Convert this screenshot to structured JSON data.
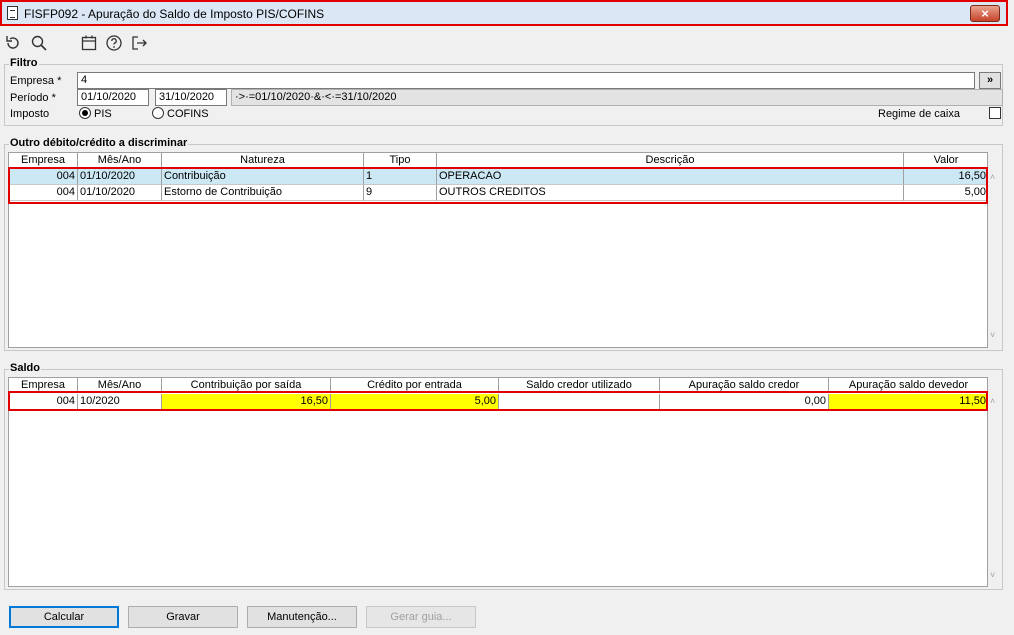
{
  "window": {
    "title": "FISFP092 - Apuração do Saldo de Imposto PIS/COFINS",
    "close_label": "×"
  },
  "toolbar": {
    "icons": [
      "undo-icon",
      "search-icon",
      "calendar-icon",
      "help-icon",
      "exit-icon"
    ]
  },
  "filtro": {
    "legend": "Filtro",
    "empresa_label": "Empresa *",
    "empresa_value": "4",
    "more_button": "»",
    "periodo_label": "Período *",
    "periodo_inicio": "01/10/2020",
    "periodo_fim": "31/10/2020",
    "periodo_expr": "·>·=01/10/2020·&·<·=31/10/2020",
    "imposto_label": "Imposto",
    "imposto_options": [
      "PIS",
      "COFINS"
    ],
    "imposto_selected": "PIS",
    "regime_label": "Regime de caixa"
  },
  "outro": {
    "legend": "Outro débito/crédito a discriminar",
    "columns": [
      "Empresa",
      "Mês/Ano",
      "Natureza",
      "Tipo",
      "Descrição",
      "Valor"
    ],
    "rows": [
      [
        "004",
        "01/10/2020",
        "Contribuição",
        "1",
        "OPERACAO",
        "16,50"
      ],
      [
        "004",
        "01/10/2020",
        "Estorno de Contribuição",
        "9",
        "OUTROS CREDITOS",
        "5,00"
      ]
    ]
  },
  "saldo": {
    "legend": "Saldo",
    "columns": [
      "Empresa",
      "Mês/Ano",
      "Contribuição por saída",
      "Crédito por entrada",
      "Saldo credor utilizado",
      "Apuração saldo credor",
      "Apuração saldo devedor"
    ],
    "rows": [
      [
        "004",
        "10/2020",
        "16,50",
        "5,00",
        "",
        "0,00",
        "11,50"
      ]
    ]
  },
  "buttons": {
    "calcular": "Calcular",
    "gravar": "Gravar",
    "manutencao": "Manutenção...",
    "gerar_guia": "Gerar guia..."
  },
  "colors": {
    "highlight_red": "#e00000",
    "selected_row": "#cce8f4",
    "yellow_cells": "#ffff00"
  }
}
